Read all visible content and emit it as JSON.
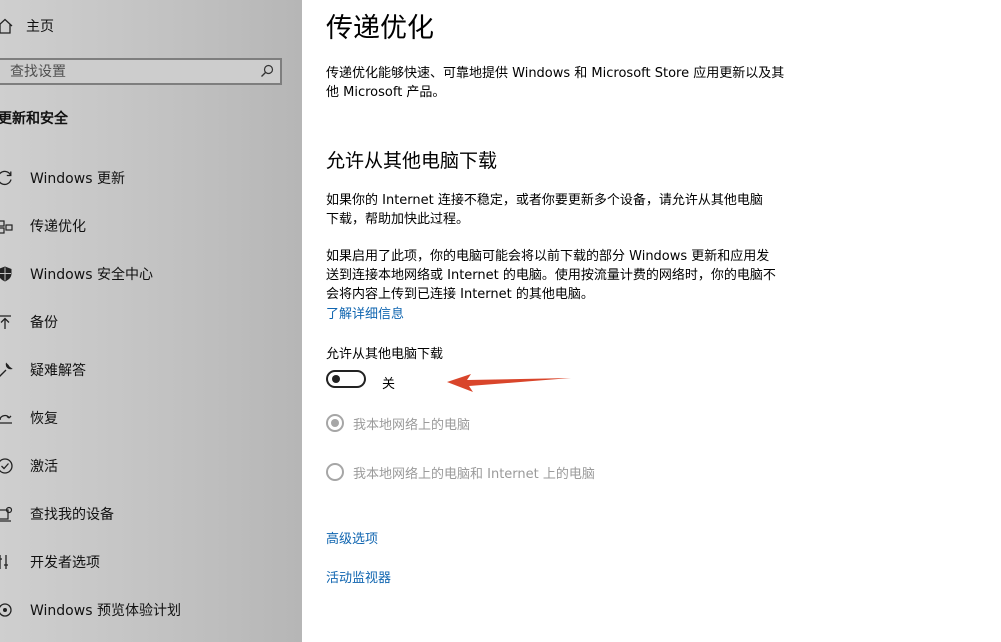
{
  "sidebar": {
    "home_label": "主页",
    "search_placeholder": "查找设置",
    "section_title": "更新和安全",
    "items": [
      {
        "label": "Windows 更新",
        "icon": "refresh-icon"
      },
      {
        "label": "传递优化",
        "icon": "delivery-optimization-icon"
      },
      {
        "label": "Windows 安全中心",
        "icon": "shield-icon"
      },
      {
        "label": "备份",
        "icon": "upload-arrow-icon"
      },
      {
        "label": "疑难解答",
        "icon": "wrench-icon"
      },
      {
        "label": "恢复",
        "icon": "recovery-icon"
      },
      {
        "label": "激活",
        "icon": "check-circle-icon"
      },
      {
        "label": "查找我的设备",
        "icon": "find-device-icon"
      },
      {
        "label": "开发者选项",
        "icon": "developer-icon"
      },
      {
        "label": "Windows 预览体验计划",
        "icon": "insider-icon"
      }
    ]
  },
  "main": {
    "title": "传递优化",
    "intro": "传递优化能够快速、可靠地提供 Windows 和 Microsoft Store 应用更新以及其他 Microsoft 产品。",
    "section_title": "允许从其他电脑下载",
    "para1": "如果你的 Internet 连接不稳定，或者你要更新多个设备，请允许从其他电脑下载，帮助加快此过程。",
    "para2": "如果启用了此项，你的电脑可能会将以前下载的部分 Windows 更新和应用发送到连接本地网络或 Internet 的电脑。使用按流量计费的网络时，你的电脑不会将内容上传到已连接 Internet 的其他电脑。",
    "learn_more": "了解详细信息",
    "toggle_label": "允许从其他电脑下载",
    "toggle_state": "关",
    "toggle_on": false,
    "radio_options": [
      {
        "label": "我本地网络上的电脑",
        "checked": true
      },
      {
        "label": "我本地网络上的电脑和 Internet 上的电脑",
        "checked": false
      }
    ],
    "advanced_link": "高级选项",
    "monitor_link": "活动监视器"
  },
  "colors": {
    "link": "#0f65b0",
    "annotation_arrow": "#d9452b",
    "sidebar_bg": "#c4c4c4"
  }
}
